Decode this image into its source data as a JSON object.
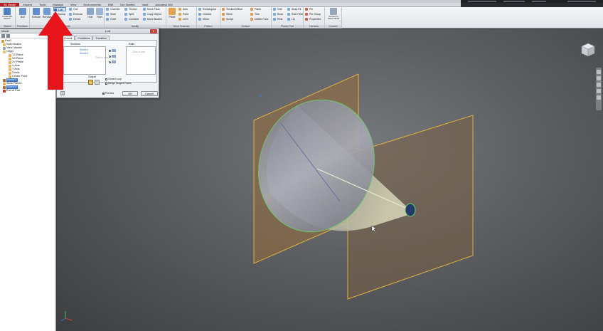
{
  "tabs": [
    "3D Model",
    "Inspect",
    "Tools",
    "Manage",
    "View",
    "Environments",
    "BIM",
    "Get Started",
    "Vault",
    "Autodesk 360"
  ],
  "ribbon": {
    "panels": [
      "Sketch",
      "Primitives",
      "Create",
      "Modify",
      "Work Features",
      "Pattern",
      "Surface",
      "Plastic Part",
      "Harness",
      "Convert"
    ],
    "create_2d_sketch": "Create 2D Sketch",
    "box": "Box",
    "extrude": "Extrude",
    "revolve": "Revolve",
    "loft": "Loft",
    "sweep": "Sweep",
    "coil": "Coil",
    "emboss": "Emboss",
    "derive": "Derive",
    "hole": "Hole",
    "fillet": "Fillet",
    "chamfer": "Chamfer",
    "shell": "Shell",
    "draft": "Draft",
    "thread": "Thread",
    "split": "Split",
    "combine": "Combine",
    "move_face": "Move Face",
    "copy_object": "Copy Object",
    "move_bodies": "Move Bodies",
    "plane": "Plane",
    "axis": "Axis",
    "point": "Point",
    "ucs": "UCS",
    "rectangular": "Rectangular",
    "circular": "Circular",
    "mirror": "Mirror",
    "thicken_offset": "Thicken/Offset",
    "stitch": "Stitch",
    "sculpt": "Sculpt",
    "patch": "Patch",
    "trim": "Trim",
    "delete_face": "Delete Face",
    "grill": "Grill",
    "boss": "Boss",
    "rest": "Rest",
    "snap_fit": "Snap Fit",
    "rule_fillet": "Rule Fillet",
    "lip": "Lip",
    "pin": "Pin",
    "pin_group": "Pin Group",
    "properties": "Properties",
    "convert_sheet_metal": "Convert to Sheet Metal"
  },
  "browser": {
    "title": "Model",
    "items": [
      {
        "label": "Part1",
        "selected": false
      },
      {
        "label": "Solid Bodies",
        "selected": false
      },
      {
        "label": "View: Master",
        "selected": false
      },
      {
        "label": "Origin",
        "selected": false
      },
      {
        "label": "YZ Plane",
        "selected": false
      },
      {
        "label": "XZ Plane",
        "selected": false
      },
      {
        "label": "XY Plane",
        "selected": false
      },
      {
        "label": "X Axis",
        "selected": false
      },
      {
        "label": "Y Axis",
        "selected": false
      },
      {
        "label": "Z Axis",
        "selected": false
      },
      {
        "label": "Center Point",
        "selected": false
      },
      {
        "label": "Sketch1",
        "selected": true
      },
      {
        "label": "Work Plane1",
        "selected": false
      },
      {
        "label": "Sketch2",
        "selected": true
      },
      {
        "label": "End of Part",
        "selected": false
      }
    ]
  },
  "loft": {
    "title": "Loft",
    "close": "X",
    "tabs": [
      "Curves",
      "Conditions",
      "Transition"
    ],
    "sections_title": "Sections",
    "section1": "Sketch1",
    "section2": "Sketch2",
    "click_to_add": "Click to add",
    "rails_title": "Rails",
    "rails_click_to_add": "Click to add",
    "output_title": "Output",
    "closed_loop": "Closed Loop",
    "merge_tangent_faces": "Merge Tangent Faces",
    "ok": "OK",
    "cancel": "Cancel",
    "preview": "Preview"
  }
}
